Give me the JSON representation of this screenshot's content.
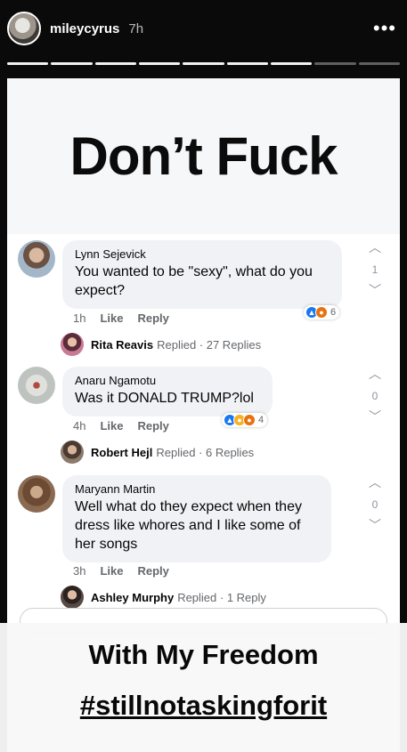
{
  "story": {
    "username": "mileycyrus",
    "time": "7h",
    "more_icon": "more-horizontal-icon",
    "progress_segments": 9
  },
  "post": {
    "headline": "Don’t Fuck"
  },
  "comments": [
    {
      "author": "Lynn Sejevick",
      "text": "You wanted to be \"sexy\", what do you expect?",
      "time": "1h",
      "like_label": "Like",
      "reply_label": "Reply",
      "reactions": [
        "like-icon",
        "angry-icon"
      ],
      "reaction_count": "6",
      "votes": "1",
      "reply_author": "Rita Reavis",
      "reply_summary": "Replied · 27 Replies"
    },
    {
      "author": "Anaru Ngamotu",
      "text": "Was it DONALD TRUMP?lol",
      "time": "4h",
      "like_label": "Like",
      "reply_label": "Reply",
      "reactions": [
        "like-icon",
        "haha-icon",
        "angry-icon"
      ],
      "reaction_count": "4",
      "votes": "0",
      "reply_author": "Robert Hejl",
      "reply_summary": "Replied · 6 Replies"
    },
    {
      "author": "Maryann Martin",
      "text": "Well what do they expect when they dress like whores and I like some of her songs",
      "time": "3h",
      "like_label": "Like",
      "reply_label": "Reply",
      "reactions": [],
      "reaction_count": "",
      "votes": "0",
      "reply_author": "Ashley Murphy",
      "reply_summary": "Replied · 1 Reply"
    }
  ],
  "overlay": {
    "line1": "With My Freedom",
    "line2": "#stillnotaskingforit"
  },
  "colors": {
    "like": "#1877f2",
    "angry": "#e9710f",
    "haha": "#f7b125",
    "bubble": "#f0f2f5",
    "meta_text": "#65676b"
  }
}
